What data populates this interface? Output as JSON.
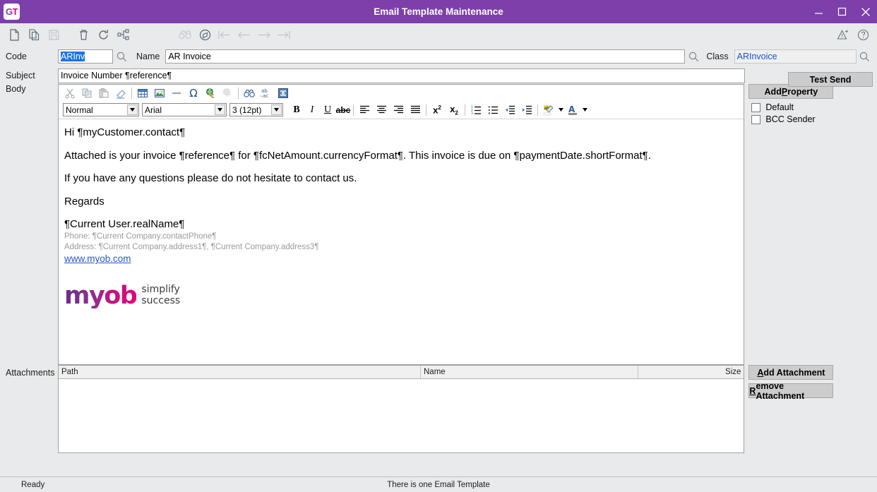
{
  "window": {
    "title": "Email Template Maintenance",
    "logo_text": "GT",
    "minimize_label": "Minimize",
    "maximize_label": "Maximize",
    "close_label": "Close"
  },
  "toolbar": {
    "icons": [
      {
        "name": "new-icon",
        "label": "New",
        "enabled": true
      },
      {
        "name": "copy-icon",
        "label": "Copy",
        "enabled": true
      },
      {
        "name": "save-icon",
        "label": "Save",
        "enabled": false
      },
      {
        "name": "delete-icon",
        "label": "Delete",
        "enabled": true
      },
      {
        "name": "refresh-icon",
        "label": "Refresh",
        "enabled": true
      },
      {
        "name": "workflow-icon",
        "label": "Workflow",
        "enabled": true
      },
      {
        "name": "find-icon",
        "label": "Find",
        "enabled": false
      },
      {
        "name": "navigate-icon",
        "label": "Navigate",
        "enabled": true
      },
      {
        "name": "first-record-icon",
        "label": "First",
        "enabled": false
      },
      {
        "name": "previous-record-icon",
        "label": "Previous",
        "enabled": false
      },
      {
        "name": "next-record-icon",
        "label": "Next",
        "enabled": false
      },
      {
        "name": "last-record-icon",
        "label": "Last",
        "enabled": false
      },
      {
        "name": "warning-icon",
        "label": "Warnings",
        "enabled": true
      },
      {
        "name": "help-icon",
        "label": "Help",
        "enabled": true
      }
    ]
  },
  "identity": {
    "code_label": "Code",
    "code_value": "ARInv",
    "name_label": "Name",
    "name_value": "AR Invoice",
    "class_label": "Class",
    "class_value": "ARInvoice"
  },
  "subject": {
    "label": "Subject",
    "value": "Invoice Number ¶reference¶"
  },
  "body": {
    "label": "Body",
    "editor_toolbar_row1": [
      {
        "name": "cut-icon",
        "label": "Cut"
      },
      {
        "name": "copy-icon",
        "label": "Copy"
      },
      {
        "name": "paste-icon",
        "label": "Paste"
      },
      {
        "name": "eraser-icon",
        "label": "Remove Format"
      },
      {
        "name": "table-icon",
        "label": "Insert Table"
      },
      {
        "name": "image-icon",
        "label": "Insert Image"
      },
      {
        "name": "horizontal-rule-icon",
        "label": "Horizontal Rule"
      },
      {
        "name": "special-character-icon",
        "label": "Special Character"
      },
      {
        "name": "insert-link-icon",
        "label": "Insert Link"
      },
      {
        "name": "remove-link-icon",
        "label": "Remove Link"
      },
      {
        "name": "find-replace-icon",
        "label": "Find and Replace"
      },
      {
        "name": "spell-check-icon",
        "label": "Spell Check"
      },
      {
        "name": "source-view-icon",
        "label": "Source"
      }
    ],
    "style_select": "Normal",
    "font_select": "Arial",
    "size_select": "3 (12pt)",
    "format_buttons": [
      {
        "name": "bold-button",
        "label": "B"
      },
      {
        "name": "italic-button",
        "label": "I"
      },
      {
        "name": "underline-button",
        "label": "U"
      },
      {
        "name": "strikethrough-button",
        "label": "abc"
      }
    ],
    "align_buttons": [
      {
        "name": "align-left-button",
        "label": "Align Left"
      },
      {
        "name": "align-center-button",
        "label": "Align Center"
      },
      {
        "name": "align-right-button",
        "label": "Align Right"
      },
      {
        "name": "align-justify-button",
        "label": "Justify"
      }
    ],
    "script_buttons": [
      {
        "name": "superscript-button",
        "label": "x2"
      },
      {
        "name": "subscript-button",
        "label": "x2"
      }
    ],
    "list_buttons": [
      {
        "name": "ordered-list-button",
        "label": "Numbered List"
      },
      {
        "name": "unordered-list-button",
        "label": "Bullet List"
      },
      {
        "name": "outdent-button",
        "label": "Decrease Indent"
      },
      {
        "name": "indent-button",
        "label": "Increase Indent"
      }
    ],
    "color_buttons": [
      {
        "name": "highlight-color-button",
        "label": "Highlight Color"
      },
      {
        "name": "font-color-button",
        "label": "Font Color"
      }
    ],
    "content": {
      "greeting": "Hi ¶myCustomer.contact¶",
      "paragraph1": "Attached is your invoice ¶reference¶ for ¶fcNetAmount.currencyFormat¶.  This invoice is due on ¶paymentDate.shortFormat¶.",
      "paragraph2": "If you have any questions please do not hesitate to contact us.",
      "closing": "Regards",
      "signature_name": "¶Current User.realName¶",
      "signature_phone": "Phone: ¶Current Company.contactPhone¶",
      "signature_address": "Address: ¶Current Company.address1¶, ¶Current Company.address3¶",
      "signature_link": "www.myob.com",
      "logo_word": "myob",
      "logo_tagline_line1": "simplify",
      "logo_tagline_line2": "success"
    }
  },
  "side_panel": {
    "test_send_label": "Test Send",
    "add_property_label_pre": "Add ",
    "add_property_label_key": "P",
    "add_property_label_post": "roperty",
    "default_checkbox_label": "Default",
    "default_checked": false,
    "bcc_sender_checkbox_label": "BCC Sender",
    "bcc_sender_checked": false,
    "add_attachment_key": "A",
    "add_attachment_post": "dd Attachment",
    "remove_attachment_key": "R",
    "remove_attachment_post": "emove Attachment"
  },
  "attachments": {
    "label": "Attachments",
    "columns": [
      "Path",
      "Name",
      "Size"
    ],
    "rows": []
  },
  "statusbar": {
    "left": "Ready",
    "center": "There is one Email Template"
  },
  "colors": {
    "title_bar": "#7d3faa",
    "accent_magenta": "#e5007d",
    "selection_blue": "#1a73e8",
    "link_blue": "#2b56c5",
    "readonly_text": "#1a4fd6"
  }
}
